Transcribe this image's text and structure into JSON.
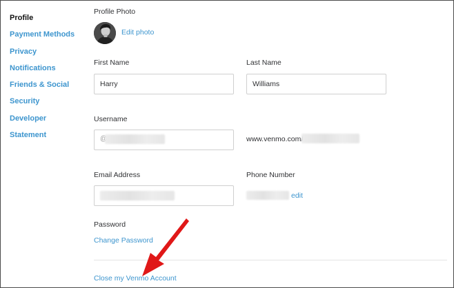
{
  "sidebar": {
    "items": [
      {
        "label": "Profile",
        "active": true
      },
      {
        "label": "Payment Methods",
        "active": false
      },
      {
        "label": "Privacy",
        "active": false
      },
      {
        "label": "Notifications",
        "active": false
      },
      {
        "label": "Friends & Social",
        "active": false
      },
      {
        "label": "Security",
        "active": false
      },
      {
        "label": "Developer",
        "active": false
      },
      {
        "label": "Statement",
        "active": false
      }
    ]
  },
  "profile_photo": {
    "label": "Profile Photo",
    "edit_link": "Edit photo"
  },
  "first_name": {
    "label": "First Name",
    "value": "Harry"
  },
  "last_name": {
    "label": "Last Name",
    "value": "Williams"
  },
  "username": {
    "label": "Username",
    "prefix": "@",
    "profile_url_prefix": "www.venmo.com/u/"
  },
  "email": {
    "label": "Email Address"
  },
  "phone": {
    "label": "Phone Number",
    "edit_link": "edit"
  },
  "password": {
    "label": "Password",
    "change_link": "Change Password"
  },
  "close_account": {
    "link": "Close my Venmo Account"
  },
  "colors": {
    "accent": "#3d95ce",
    "annotation_arrow": "#e01818"
  }
}
